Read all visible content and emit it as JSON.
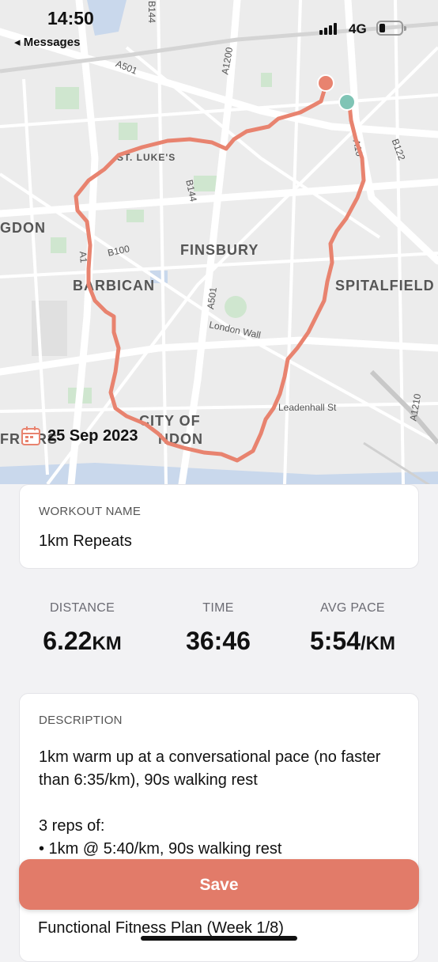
{
  "status_bar": {
    "time": "14:50",
    "back_label": "◂ Messages",
    "network": "4G"
  },
  "map": {
    "area_labels": [
      "ST. LUKE'S",
      "FINSBURY",
      "BARBICAN",
      "SPITALFIELD",
      "GDON",
      "CITY OF",
      "NDON",
      "FRIARS"
    ],
    "road_labels": [
      "A501",
      "B144",
      "A1200",
      "A10",
      "B122",
      "B144",
      "B100",
      "A1",
      "A501",
      "London Wall",
      "Leadenhall St",
      "A1210"
    ],
    "route_color": "#e8836f",
    "start_marker_color": "#e8836f",
    "end_marker_color": "#7fc4b5"
  },
  "date": {
    "icon": "calendar-icon",
    "text": "25 Sep 2023"
  },
  "workout": {
    "name_label": "WORKOUT NAME",
    "name_value": "1km Repeats"
  },
  "stats": {
    "distance_label": "DISTANCE",
    "distance_value": "6.22",
    "distance_unit": "KM",
    "time_label": "TIME",
    "time_value": "36:46",
    "pace_label": "AVG PACE",
    "pace_value": "5:54",
    "pace_unit": "/KM"
  },
  "description": {
    "label": "DESCRIPTION",
    "line1": "1km warm up at a conversational pace (no faster than 6:35/km), 90s walking rest",
    "line2": "3 reps of:",
    "line3": "• 1km @ 5:40/km, 90s walking rest"
  },
  "save_button": {
    "label": "Save",
    "color": "#e27b69"
  },
  "plan": {
    "text": "Functional Fitness Plan (Week 1/8)"
  }
}
